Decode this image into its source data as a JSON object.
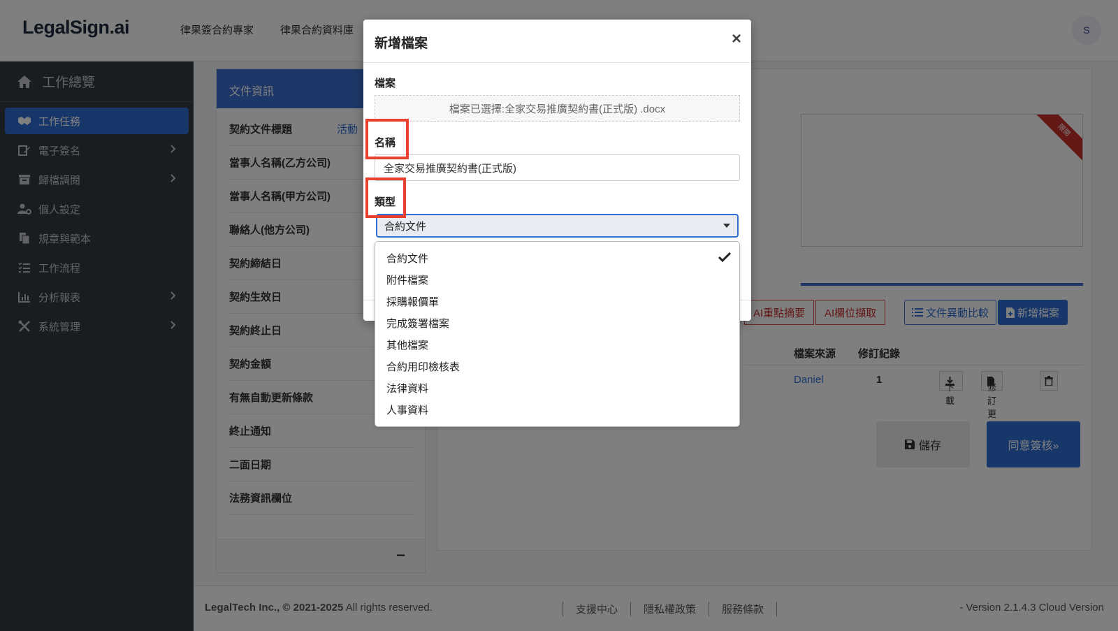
{
  "topbar": {
    "logo": "LegalSign.ai",
    "nav": [
      "律果簽合約專家",
      "律果合約資料庫"
    ],
    "avatar_initial": "S"
  },
  "sidebar": {
    "overview": "工作總覽",
    "items": [
      {
        "label": "工作任務",
        "icon": "handshake-icon",
        "active": true,
        "chevron": false
      },
      {
        "label": "電子簽名",
        "icon": "signature-icon",
        "active": false,
        "chevron": true
      },
      {
        "label": "歸檔調閱",
        "icon": "archive-icon",
        "active": false,
        "chevron": true
      },
      {
        "label": "個人設定",
        "icon": "user-gear-icon",
        "active": false,
        "chevron": false
      },
      {
        "label": "規章與範本",
        "icon": "copy-icon",
        "active": false,
        "chevron": false
      },
      {
        "label": "工作流程",
        "icon": "list-check-icon",
        "active": false,
        "chevron": false
      },
      {
        "label": "分析報表",
        "icon": "chart-icon",
        "active": false,
        "chevron": true
      },
      {
        "label": "系統管理",
        "icon": "tools-icon",
        "active": false,
        "chevron": true
      }
    ]
  },
  "left_card": {
    "header": "文件資訊",
    "fields": [
      "契約文件標題",
      "當事人名稱(乙方公司)",
      "當事人名稱(甲方公司)",
      "聯絡人(他方公司)",
      "契約締結日",
      "契約生效日",
      "契約終止日",
      "契約金額",
      "有無自動更新條款",
      "終止通知",
      "二面日期",
      "法務資訊欄位"
    ],
    "title_value_partial": "活動",
    "collapse": "−"
  },
  "right_card": {
    "ribbon": "限閱",
    "buttons": {
      "ai_summary": "AI重點摘要",
      "ai_extract": "AI欄位擷取",
      "compare": "文件異動比較",
      "add_file": "新增檔案"
    },
    "table": {
      "headers": {
        "source": "檔案來源",
        "revision": "修訂紀錄"
      },
      "row": {
        "source": "Daniel",
        "revision": "1",
        "download": "下載",
        "update": "修訂更新"
      }
    },
    "save": "儲存",
    "approve": "同意簽核»"
  },
  "footer": {
    "company": "LegalTech Inc., © 2021-2025",
    "rights": " All rights reserved.",
    "links": [
      "支援中心",
      "隱私權政策",
      "服務條款"
    ],
    "version": "- Version 2.1.4.3 Cloud Version"
  },
  "modal": {
    "title": "新增檔案",
    "close": "×",
    "file_label": "檔案",
    "file_selected": "檔案已選擇:全家交易推廣契約書(正式版) .docx",
    "name_label": "名稱",
    "name_value": "全家交易推廣契約書(正式版)",
    "type_label": "類型",
    "type_value": "合約文件",
    "type_options": [
      "合約文件",
      "附件檔案",
      "採購報價單",
      "完成簽署檔案",
      "其他檔案",
      "合約用印檢核表",
      "法律資料",
      "人事資料"
    ]
  },
  "colors": {
    "primary": "#2f6fd6",
    "sidebar_bg": "#343a40",
    "highlight": "#e8412f",
    "danger": "#c9302c"
  }
}
